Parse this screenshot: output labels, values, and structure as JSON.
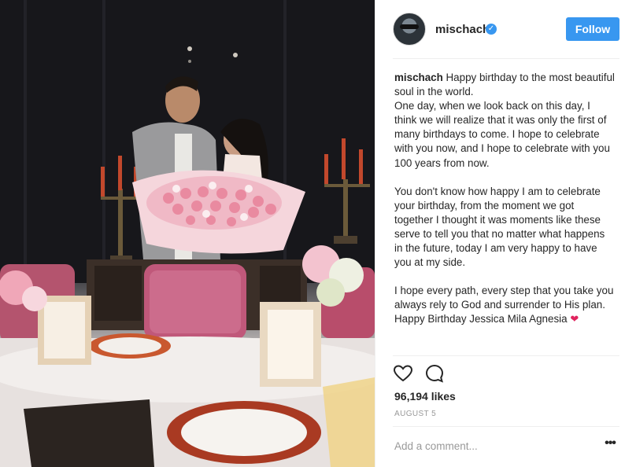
{
  "header": {
    "username": "mischach",
    "verified_icon": "verified-badge-icon",
    "follow_label": "Follow",
    "accent": "#3897f0"
  },
  "caption": {
    "username": "mischach",
    "line1": "Happy birthday to the most beautiful soul in the world.",
    "para1": "One day, when we look back on this day, I think we will realize that it was only the first of many birthdays to come. I hope to celebrate with you now, and I hope to celebrate with you 100 years from now.",
    "para2": "You don't know how happy I am to celebrate your birthday, from the moment we got together I thought it was moments like these serve to tell you that no matter what happens in the future, today I am very happy to have you at my side.",
    "para3": "I hope every path, every step that you take you always rely to God and surrender to His plan.",
    "closing": "Happy Birthday Jessica Mila Agnesia",
    "closing_emoji": "❤"
  },
  "actions": {
    "like_icon": "heart-outline-icon",
    "comment_icon": "comment-bubble-icon"
  },
  "stats": {
    "likes": "96,194 likes",
    "date": "AUGUST 5"
  },
  "comment": {
    "placeholder": "Add a comment...",
    "more_label": "•••"
  },
  "photo": {
    "description_icon": "post-photo"
  }
}
